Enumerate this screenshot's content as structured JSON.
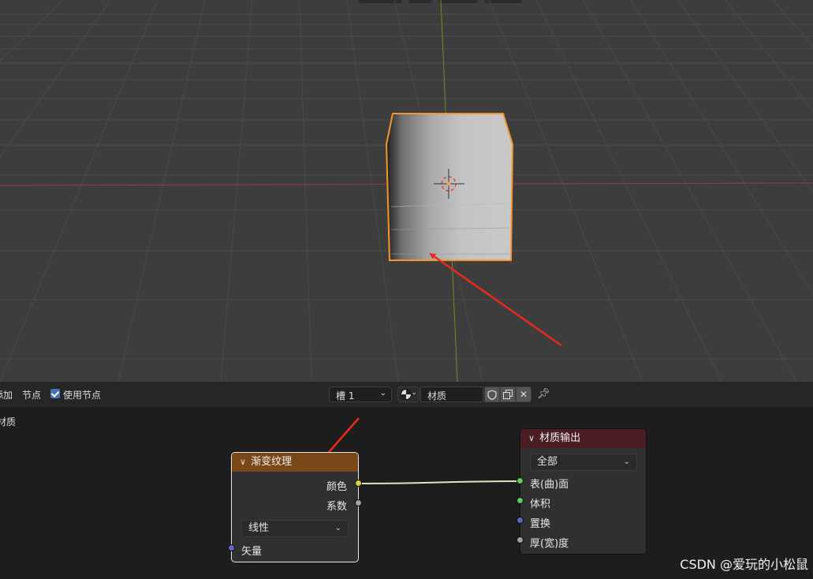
{
  "node_header": {
    "menu_add": "添加",
    "menu_node": "节点",
    "use_nodes_label": "使用节点",
    "use_nodes_checked": true,
    "slot_select": "槽 1",
    "material_name": "材质"
  },
  "canvas": {
    "breadcrumb": "材质"
  },
  "gradient_node": {
    "title": "渐变纹理",
    "output_color": "颜色",
    "output_factor": "系数",
    "type_dropdown": "线性",
    "input_vector": "矢量",
    "header_color": "#7a4718"
  },
  "output_node": {
    "title": "材质输出",
    "target_dropdown": "全部",
    "input_surface": "表(曲)面",
    "input_volume": "体积",
    "input_displacement": "置换",
    "input_thickness": "厚(宽)度",
    "header_color": "#4a1c24"
  },
  "watermark": "CSDN @爱玩的小松鼠",
  "colors": {
    "selection_outline": "#f5952f",
    "annotation_arrow": "#e8291c",
    "socket_color": "#d6d43a",
    "socket_shader": "#63c763",
    "socket_vector": "#6363c7",
    "socket_float": "#a1a1a1"
  }
}
